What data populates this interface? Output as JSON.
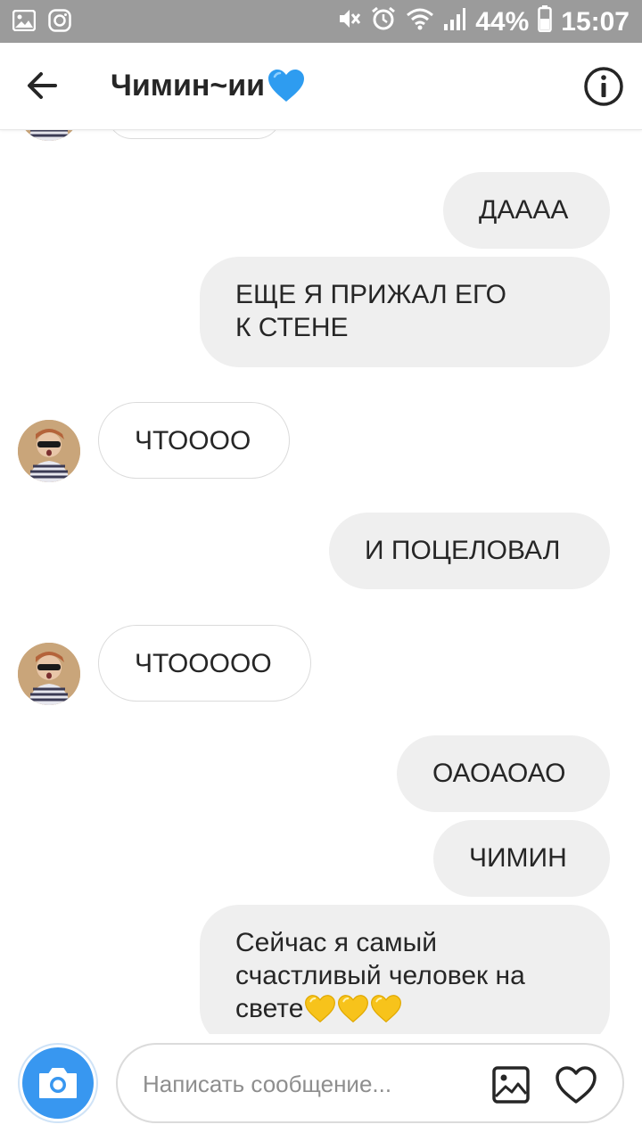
{
  "status_bar": {
    "battery": "44%",
    "time": "15:07",
    "left_icons": [
      "image-icon",
      "instagram-icon"
    ],
    "right_icons": [
      "mute-icon",
      "alarm-icon",
      "wifi-icon",
      "signal-icon",
      "battery-icon"
    ]
  },
  "header": {
    "title": "Чимин~ии",
    "title_emoji": "blue-heart-icon",
    "back_icon": "back-arrow-icon",
    "info_icon": "info-icon"
  },
  "messages": [
    {
      "from": "me",
      "lines": [
        "ДАААА"
      ]
    },
    {
      "from": "me",
      "lines": [
        "ЕЩЕ Я ПРИЖАЛ ЕГО",
        "К СТЕНЕ"
      ]
    },
    {
      "from": "them",
      "lines": [
        "ЧТОООО"
      ]
    },
    {
      "from": "me",
      "lines": [
        "И ПОЦЕЛОВАЛ"
      ]
    },
    {
      "from": "them",
      "lines": [
        "ЧТООООО"
      ]
    },
    {
      "from": "me",
      "lines": [
        "ОАОАОАО"
      ]
    },
    {
      "from": "me",
      "lines": [
        "ЧИМИН"
      ]
    },
    {
      "from": "me",
      "lines": [
        "Сейчас я самый",
        "счастливый человек на",
        "свете"
      ],
      "trailing_emoji": "yellow-heart-icon",
      "trailing_emoji_count": 3
    }
  ],
  "composer": {
    "placeholder": "Написать сообщение...",
    "camera_icon": "camera-icon",
    "gallery_icon": "gallery-icon",
    "like_icon": "heart-outline-icon"
  },
  "colors": {
    "status_bar_bg": "#9b9b9b",
    "my_bubble": "#efefef",
    "their_bubble_border": "#dbdbdb",
    "accent": "#3897f0",
    "blue_heart": "#2e9cf0",
    "yellow_heart": "#f7c31b"
  }
}
